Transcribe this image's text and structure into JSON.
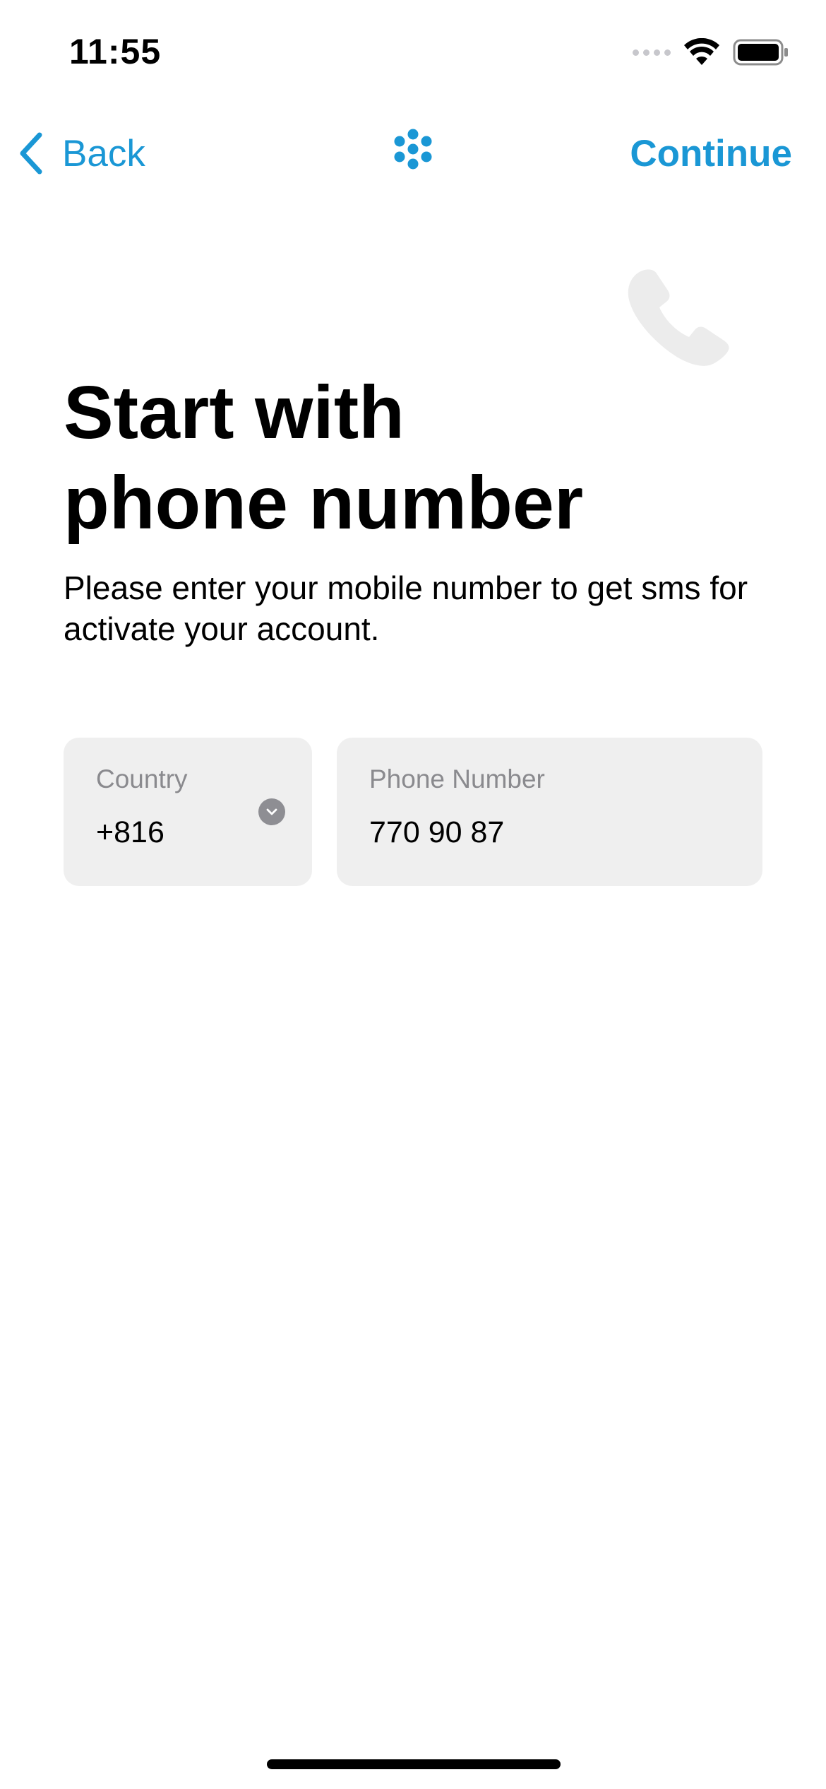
{
  "status_bar": {
    "time": "11:55",
    "icons": [
      "cellular-signal-icon",
      "wifi-icon",
      "battery-icon"
    ]
  },
  "nav": {
    "back_label": "Back",
    "continue_label": "Continue",
    "logo_icon": "app-logo-icon",
    "accent_color": "#1a97d5"
  },
  "main": {
    "title_line1": "Start with",
    "title_line2": "phone number",
    "subtitle": "Please enter your mobile number to get sms for activate your account.",
    "decorative_icon": "phone-icon"
  },
  "form": {
    "country": {
      "label": "Country",
      "value": "+816"
    },
    "phone": {
      "label": "Phone Number",
      "value": "770 90 87"
    }
  }
}
